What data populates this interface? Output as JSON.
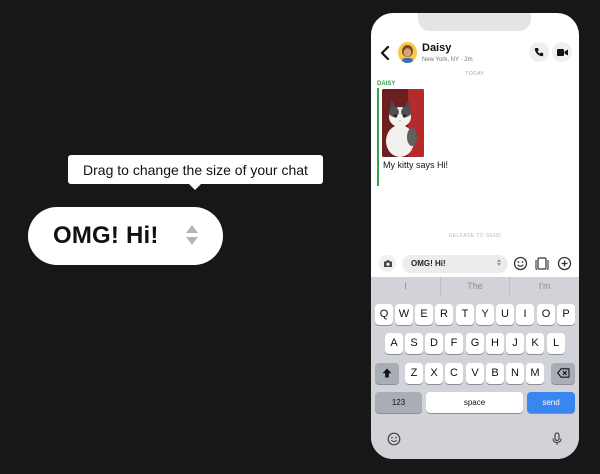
{
  "tooltip": {
    "text": "Drag to change the size of your chat"
  },
  "preview_pill": {
    "text": "OMG! Hi!"
  },
  "chat": {
    "contact_name": "Daisy",
    "location": "New York, NY · 2m",
    "date_label": "TODAY",
    "sender_label": "DAISY",
    "message_text": "My kitty says Hi!",
    "release_label": "RELEASE TO SEND",
    "input_value": "OMG! Hi!",
    "accent_green": "#35a34f"
  },
  "keyboard": {
    "suggestions": [
      "I",
      "The",
      "I'm"
    ],
    "row1": [
      "Q",
      "W",
      "E",
      "R",
      "T",
      "Y",
      "U",
      "I",
      "O",
      "P"
    ],
    "row2": [
      "A",
      "S",
      "D",
      "F",
      "G",
      "H",
      "J",
      "K",
      "L"
    ],
    "row3": [
      "Z",
      "X",
      "C",
      "V",
      "B",
      "N",
      "M"
    ],
    "numbers_label": "123",
    "space_label": "space",
    "send_label": "send",
    "send_color": "#3a86f0"
  }
}
